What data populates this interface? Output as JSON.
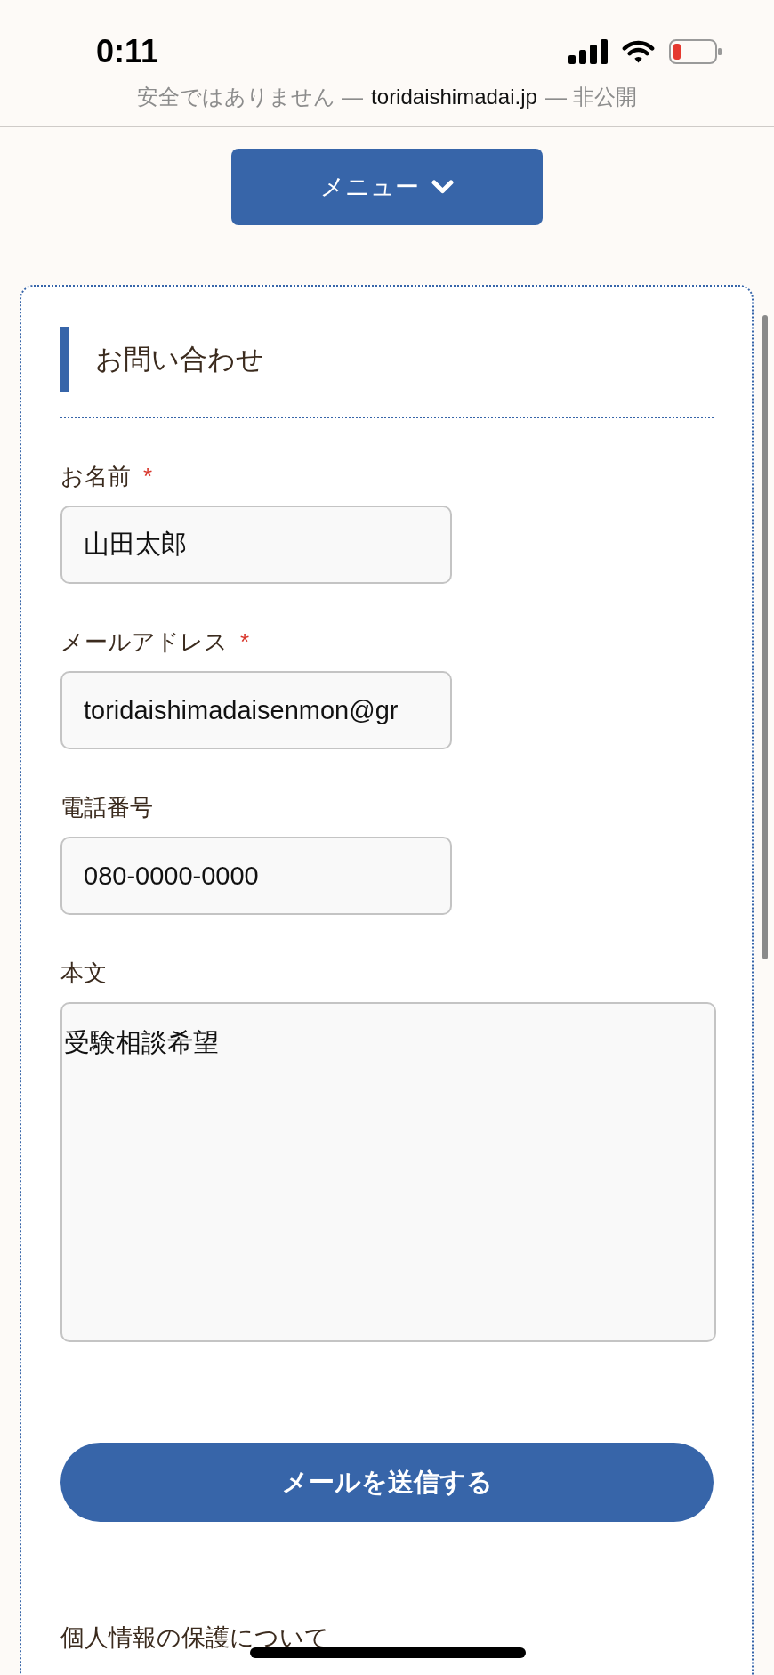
{
  "status_bar": {
    "time": "0:11"
  },
  "address_bar": {
    "security": "安全ではありません —",
    "domain": "toridaishimadai.jp",
    "privacy": "— 非公開"
  },
  "menu_button": {
    "label": "メニュー"
  },
  "contact_form": {
    "title": "お問い合わせ",
    "fields": [
      {
        "kind": "input",
        "label": "お名前",
        "required_mark": "*",
        "value": "山田太郎"
      },
      {
        "kind": "input",
        "label": "メールアドレス",
        "required_mark": "*",
        "value": "toridaishimadaisenmon@gr"
      },
      {
        "kind": "input",
        "label": "電話番号",
        "value": "080-0000-0000"
      },
      {
        "kind": "textarea",
        "label": "本文",
        "value": "受験相談希望"
      }
    ],
    "submit_button": {
      "label": "メールを送信する"
    },
    "privacy_heading": "個人情報の保護について"
  }
}
